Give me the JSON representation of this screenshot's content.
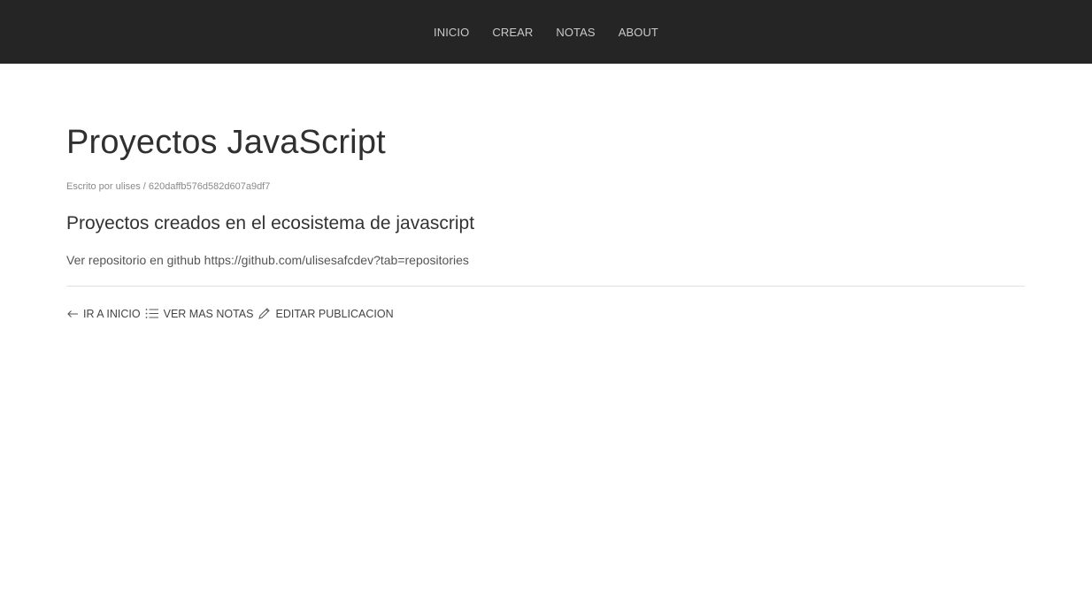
{
  "nav": {
    "items": [
      {
        "label": "INICIO"
      },
      {
        "label": "CREAR"
      },
      {
        "label": "NOTAS"
      },
      {
        "label": "ABOUT"
      }
    ]
  },
  "note": {
    "title": "Proyectos JavaScript",
    "meta": "Escrito por ulises / 620daffb576d582d607a9df7",
    "subtitle": "Proyectos creados en el ecosistema de javascript",
    "body": "Ver repositorio en github https://github.com/ulisesafcdev?tab=repositories"
  },
  "actions": {
    "home": {
      "label": "IR A INICIO",
      "icon": "arrow-left-icon"
    },
    "more": {
      "label": "VER MAS NOTAS",
      "icon": "list-icon"
    },
    "edit": {
      "label": "EDITAR PUBLICACION",
      "icon": "pencil-icon"
    }
  },
  "colors": {
    "navbar_bg": "#252525",
    "nav_text": "#c9c9c9",
    "page_bg": "#ffffff"
  }
}
